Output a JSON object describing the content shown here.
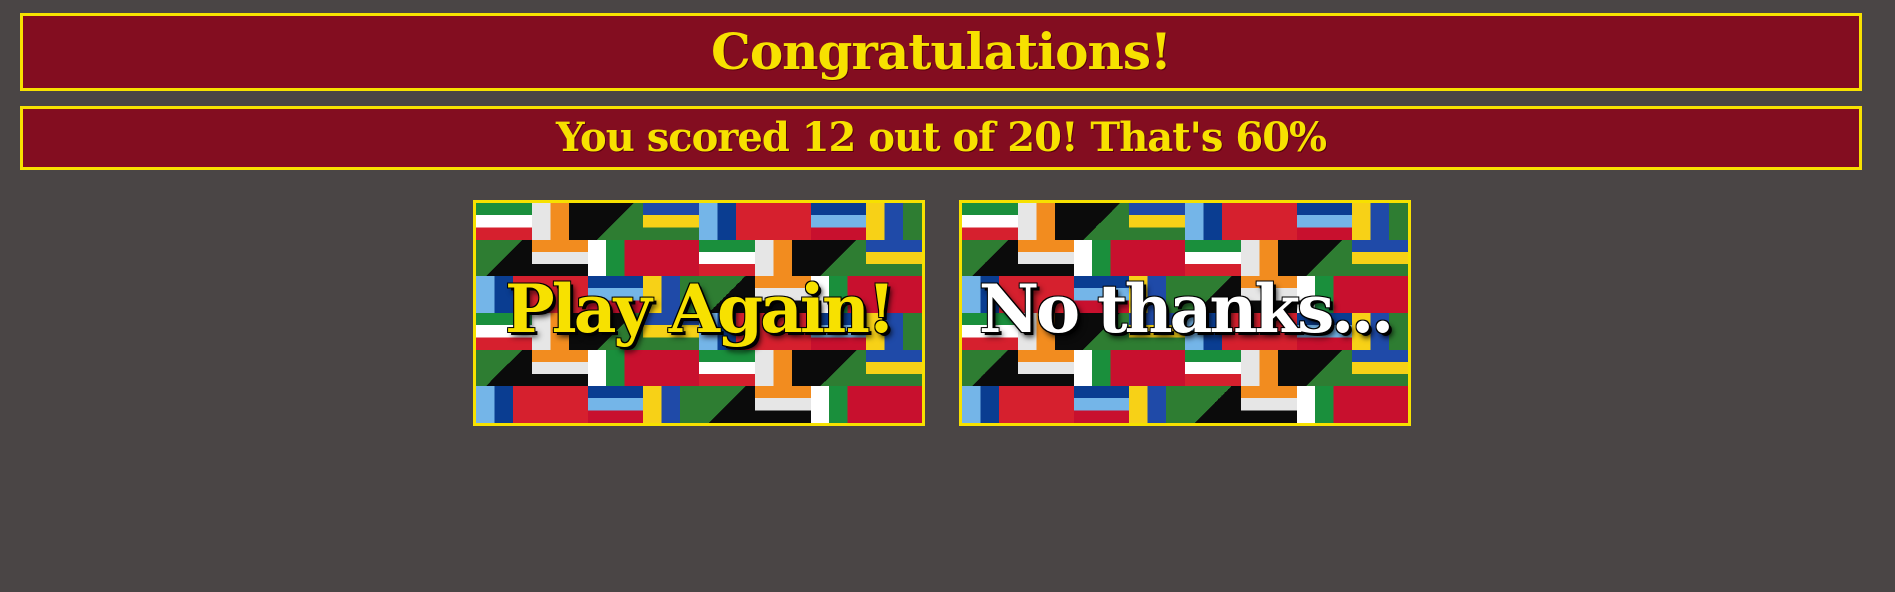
{
  "title": "Congratulations!",
  "score_text": "You scored 12 out of 20! That's 60%",
  "buttons": {
    "play_again": "Play Again!",
    "no_thanks": "No thanks..."
  },
  "colors": {
    "background": "#4a4545",
    "banner_fill": "#830d20",
    "accent_yellow": "#f7e100",
    "white": "#ffffff"
  },
  "mosaic_palette": [
    "#1f4aa8",
    "#ffffff",
    "#d6202e",
    "#1a8f3c",
    "#f7d117",
    "#0b0b0b",
    "#f28c1f",
    "#74b5e8",
    "#c8102e",
    "#0a3d91",
    "#e6e6e6",
    "#2e7d32"
  ]
}
